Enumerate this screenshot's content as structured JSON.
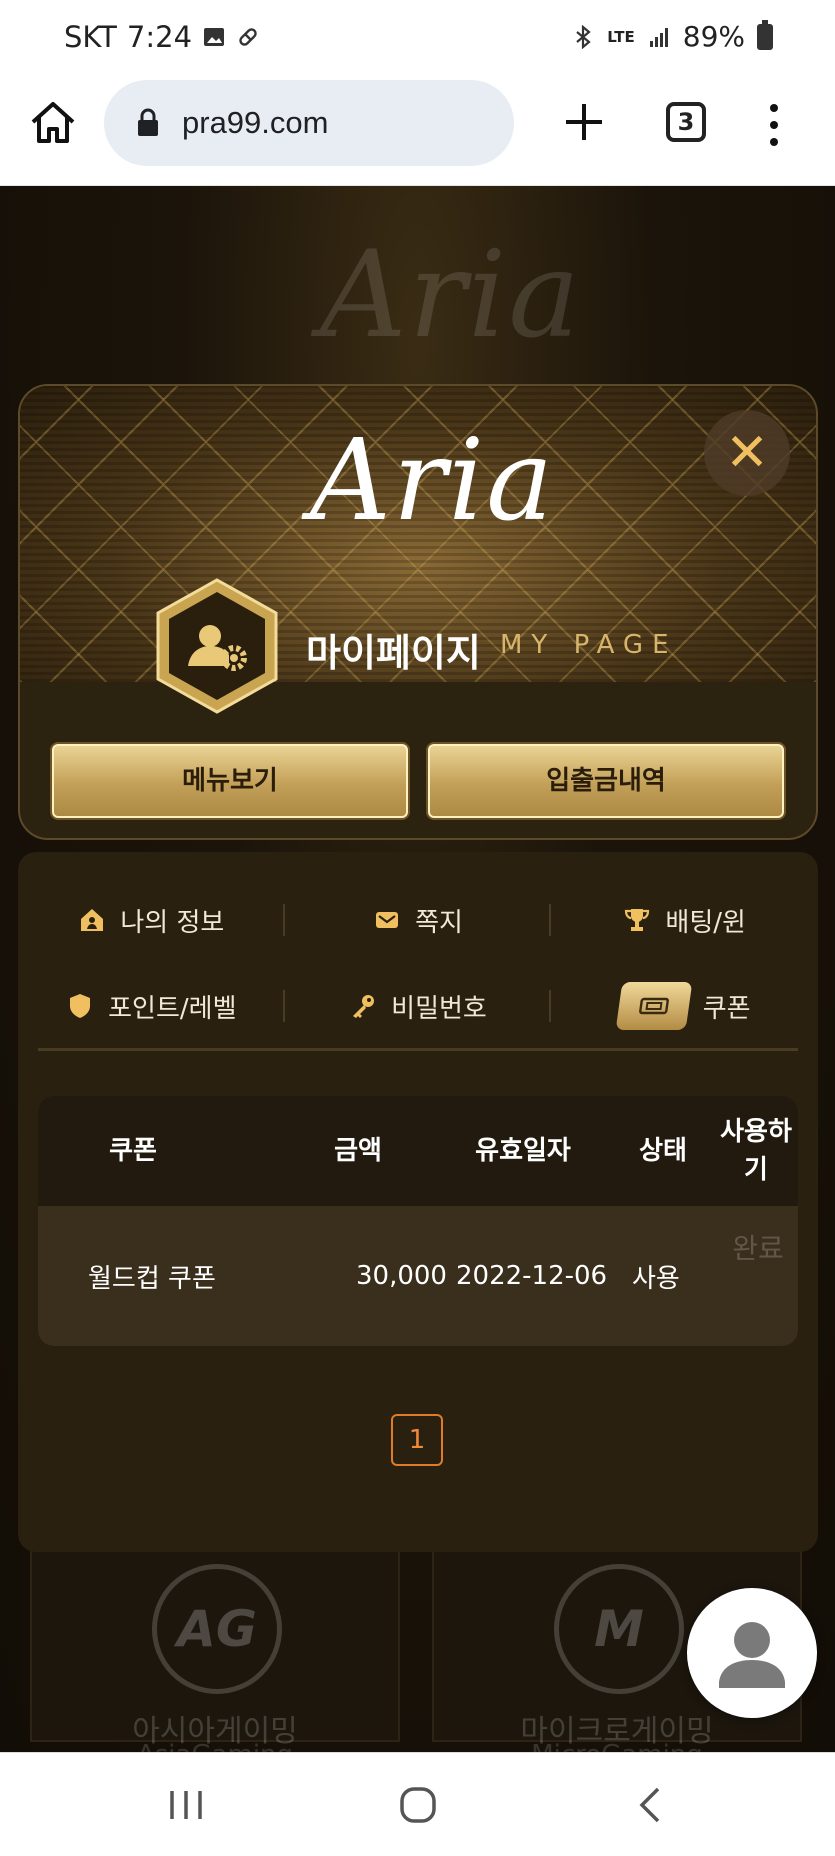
{
  "status_bar": {
    "carrier": "SKT",
    "time": "7:24",
    "network": "LTE",
    "battery": "89%"
  },
  "browser": {
    "url": "pra99.com",
    "tab_count": "3"
  },
  "background": {
    "logo": "Aria",
    "cards": [
      {
        "logo": "AG",
        "title": "아시아게이밍",
        "subtitle": "AsiaGaming"
      },
      {
        "logo": "M",
        "title": "마이크로게이밍",
        "subtitle": "MicroGaming"
      }
    ]
  },
  "header": {
    "logo": "Aria",
    "title": "마이페이지",
    "subtitle": "MY PAGE",
    "buttons": {
      "menu": "메뉴보기",
      "history": "입출금내역"
    }
  },
  "tabs": [
    {
      "label": "나의 정보",
      "icon": "house-user-icon"
    },
    {
      "label": "쪽지",
      "icon": "envelope-icon"
    },
    {
      "label": "배팅/윈",
      "icon": "trophy-icon"
    },
    {
      "label": "포인트/레벨",
      "icon": "shield-icon"
    },
    {
      "label": "비밀번호",
      "icon": "key-icon"
    },
    {
      "label": "쿠폰",
      "icon": "ticket-icon",
      "active": true
    }
  ],
  "coupon_table": {
    "headers": [
      "쿠폰",
      "금액",
      "유효일자",
      "상태",
      "사용하기"
    ],
    "rows": [
      {
        "name": "월드컵 쿠폰",
        "amount": "30,000",
        "expiry": "2022-12-06",
        "status": "사용",
        "action": "완료"
      }
    ]
  },
  "pagination": {
    "current": "1"
  },
  "colors": {
    "gold": "#c3a058",
    "accent_orange": "#e07b2a",
    "panel": "#2a200f"
  }
}
